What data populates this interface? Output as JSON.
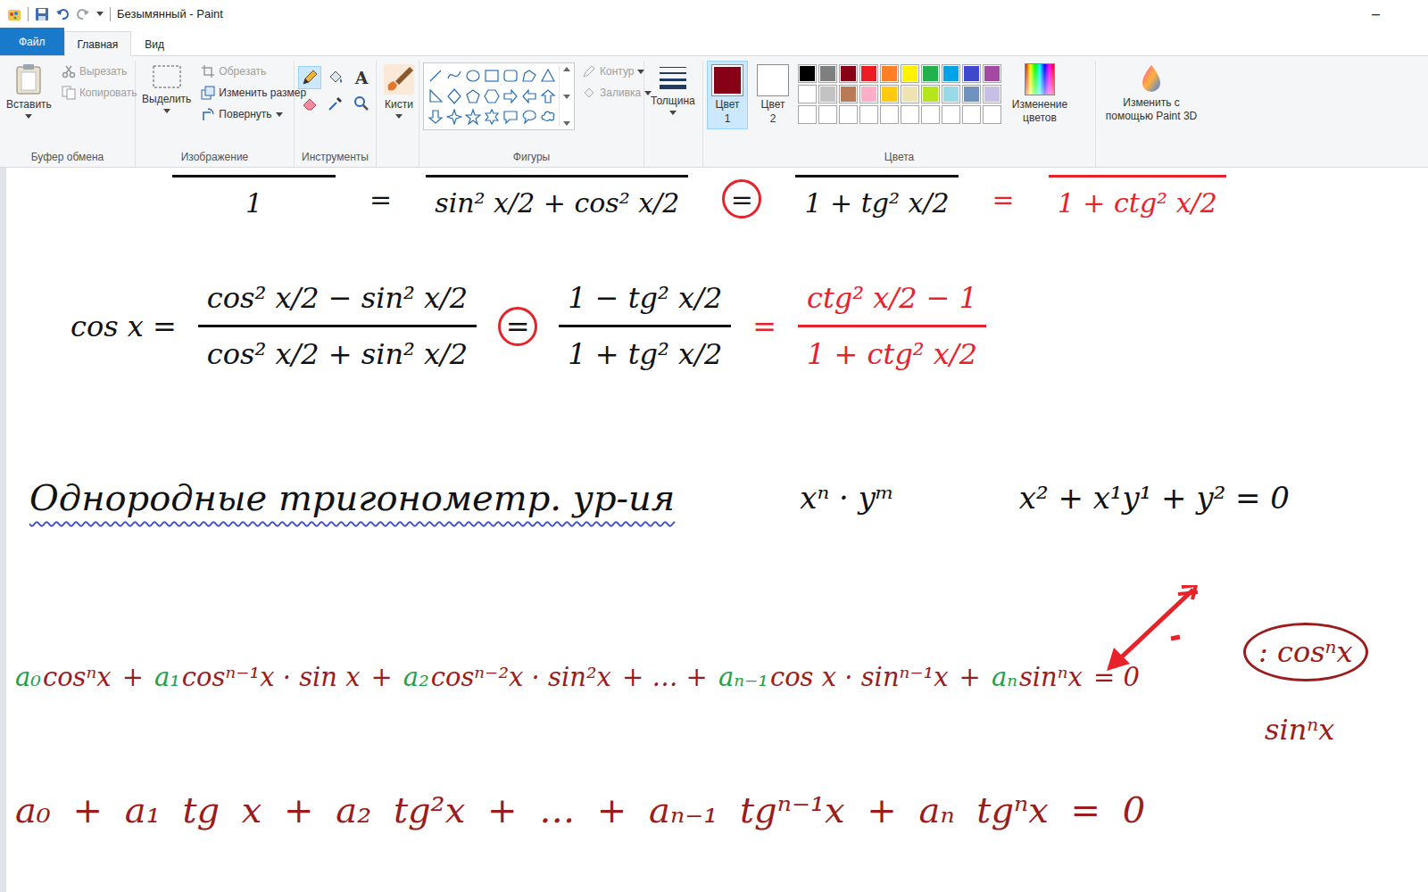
{
  "window": {
    "title": "Безымянный - Paint",
    "minimize": "–"
  },
  "menu": [
    {
      "label": "Файл",
      "selected": false,
      "kind": "file"
    },
    {
      "label": "Главная",
      "selected": true,
      "kind": "tab"
    },
    {
      "label": "Вид",
      "selected": false,
      "kind": "tab"
    }
  ],
  "ribbon": {
    "clipboard": {
      "label": "Буфер обмена",
      "paste": "Вставить",
      "cut": {
        "label": "Вырезать",
        "disabled": true
      },
      "copy": {
        "label": "Копировать",
        "disabled": true
      }
    },
    "image": {
      "label": "Изображение",
      "select": "Выделить",
      "crop": {
        "label": "Обрезать",
        "disabled": true
      },
      "resize": {
        "label": "Изменить размер",
        "disabled": false
      },
      "rotate": {
        "label": "Повернуть",
        "disabled": false
      }
    },
    "tools": {
      "label": "Инструменты",
      "items": [
        {
          "selected": true
        },
        {
          "selected": false
        },
        {
          "glyph": "A",
          "selected": false
        },
        {
          "selected": false
        },
        {
          "selected": false
        },
        {
          "selected": false
        }
      ]
    },
    "brushes": {
      "label": "Кисти"
    },
    "shapes": {
      "label": "Фигуры",
      "outline": {
        "label": "Контур",
        "disabled": true
      },
      "fill": {
        "label": "Заливка",
        "disabled": true
      }
    },
    "size": {
      "label": "Толщина"
    },
    "color1": {
      "label": "Цвет",
      "number": "1",
      "color": "#880015",
      "selected": true
    },
    "color2": {
      "label": "Цвет",
      "number": "2",
      "color": "#ffffff",
      "selected": false
    },
    "palette": {
      "label": "Цвета",
      "swatches": [
        "#000000",
        "#7f7f7f",
        "#880015",
        "#ed1c24",
        "#ff7f27",
        "#fff200",
        "#22b14c",
        "#00a2e8",
        "#3f48cc",
        "#a349a4",
        "#ffffff",
        "#c3c3c3",
        "#b97a57",
        "#ffaec9",
        "#ffc90e",
        "#efe4b0",
        "#b5e61d",
        "#99d9ea",
        "#7092be",
        "#c8bfe7",
        "#ffffff",
        "#ffffff",
        "#ffffff",
        "#ffffff",
        "#ffffff",
        "#ffffff",
        "#ffffff",
        "#ffffff",
        "#ffffff",
        "#ffffff"
      ]
    },
    "edit_colors": {
      "label": "Изменение цветов"
    },
    "paint3d": {
      "label": "Изменить с помощью Paint 3D"
    }
  },
  "canvas": {
    "lines": [
      {
        "items": [
          {
            "kind": "den",
            "den": "1",
            "color": "#111111"
          },
          {
            "kind": "text",
            "text": "=",
            "color": "#111111"
          },
          {
            "kind": "den",
            "den": "sin² x/2 + cos² x/2",
            "color": "#111111"
          },
          {
            "kind": "circled",
            "text": "=",
            "color": "#111111"
          },
          {
            "kind": "den",
            "den": "1 + tg² x/2",
            "color": "#111111"
          },
          {
            "kind": "text",
            "text": "=",
            "color": "#e8222a"
          },
          {
            "kind": "den",
            "den": "1 + ctg² x/2",
            "color": "#e8222a"
          }
        ]
      },
      {
        "items": [
          {
            "kind": "text",
            "text": "cos x =",
            "color": "#111111"
          },
          {
            "kind": "fraction",
            "num": "cos² x/2 − sin² x/2",
            "den": "cos² x/2 + sin² x/2",
            "color": "#111111"
          },
          {
            "kind": "circled",
            "text": "=",
            "color": "#111111"
          },
          {
            "kind": "fraction",
            "num": "1 − tg² x/2",
            "den": "1 + tg² x/2",
            "color": "#111111"
          },
          {
            "kind": "text",
            "text": "=",
            "color": "#e8222a"
          },
          {
            "kind": "fraction",
            "num": "ctg² x/2 − 1",
            "den": "1 + ctg² x/2",
            "color": "#e8222a"
          }
        ]
      },
      {
        "items": [
          {
            "kind": "heading",
            "text": "Однородные тригонометр. ур-ия",
            "color": "#111111"
          },
          {
            "kind": "text",
            "text": "xⁿ · yᵐ",
            "color": "#111111"
          },
          {
            "kind": "text",
            "text": "x² + x¹y¹ + y² = 0",
            "color": "#111111"
          }
        ]
      },
      {
        "items": [
          {
            "kind": "term",
            "coef": "a₀",
            "coef_color": "#1fa34a",
            "body": "cosⁿx",
            "color": "#9b1c1c"
          },
          {
            "kind": "text",
            "text": "+",
            "color": "#9b1c1c"
          },
          {
            "kind": "term",
            "coef": "a₁",
            "coef_color": "#1fa34a",
            "body": "cosⁿ⁻¹x · sin x",
            "color": "#9b1c1c"
          },
          {
            "kind": "text",
            "text": "+",
            "color": "#9b1c1c"
          },
          {
            "kind": "term",
            "coef": "a₂",
            "coef_color": "#1fa34a",
            "body": "cosⁿ⁻²x · sin²x",
            "color": "#9b1c1c"
          },
          {
            "kind": "text",
            "text": "+ … +",
            "color": "#9b1c1c"
          },
          {
            "kind": "term",
            "coef": "aₙ₋₁",
            "coef_color": "#1fa34a",
            "body": "cos x · sinⁿ⁻¹x",
            "color": "#9b1c1c"
          },
          {
            "kind": "text",
            "text": "+",
            "color": "#9b1c1c"
          },
          {
            "kind": "term",
            "coef": "aₙ",
            "coef_color": "#1fa34a",
            "body": "sinⁿx",
            "color": "#9b1c1c"
          },
          {
            "kind": "text",
            "text": "= 0",
            "color": "#9b1c1c"
          }
        ]
      },
      {
        "items": [
          {
            "kind": "text",
            "text": "a₀ + a₁ tg x + a₂ tg²x + … + aₙ₋₁ tgⁿ⁻¹x + aₙ tgⁿx = 0",
            "color": "#9b1c1c"
          }
        ]
      }
    ],
    "notes": [
      {
        "text": ": cosⁿx",
        "circled": true
      },
      {
        "text": "sinⁿx",
        "circled": false
      }
    ]
  }
}
